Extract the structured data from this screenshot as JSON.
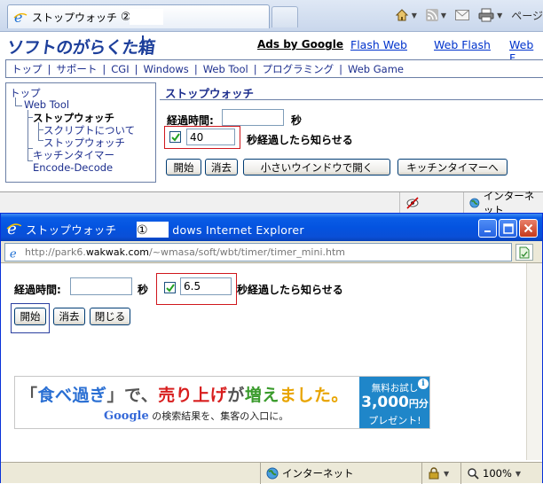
{
  "back_window": {
    "tab_title": "ストップウォッチ",
    "tab_marker": "②",
    "cmd": {
      "home_icon": "home-icon",
      "feeds_icon": "rss-icon",
      "mail_icon": "mail-icon",
      "print_icon": "printer-icon",
      "page_label": "ページ"
    },
    "logo": "ソフトのがらくた箱",
    "ads_label": "Ads by Google",
    "header_links": [
      "Flash Web",
      "Web Flash",
      "Web F"
    ],
    "nav": [
      "トップ",
      "サポート",
      "CGI",
      "Windows",
      "Web Tool",
      "プログラミング",
      "Web Game"
    ],
    "tree": {
      "top": "トップ",
      "web_tool": "Web Tool",
      "stopwatch": "ストップウォッチ",
      "about_script": "スクリプトについて",
      "stopwatch_sub": "ストップウォッチ",
      "kitchen_timer": "キッチンタイマー",
      "encode_decode": "Encode-Decode"
    },
    "content": {
      "title": "ストップウォッチ",
      "elapsed_label": "経過時間:",
      "elapsed_value": "",
      "sec_unit": "秒",
      "notify_value": "40",
      "notify_label": "秒経過したら知らせる",
      "notify_checked": true,
      "buttons": {
        "start": "開始",
        "clear": "消去",
        "open_small": "小さいウインドウで開く",
        "kitchen": "キッチンタイマーへ"
      }
    },
    "status": {
      "zone": "インターネット"
    }
  },
  "front_window": {
    "title": "ストップウォッチ",
    "title_marker": "①",
    "title_suffix": "dows Internet Explorer",
    "url_prefix": "http://park6.",
    "url_host": "wakwak.com",
    "url_path": "/~wmasa/soft/wbt/timer/timer_mini.htm",
    "elapsed_label": "経過時間:",
    "elapsed_value": "",
    "sec_unit": "秒",
    "notify_value": "6.5",
    "notify_label": "秒経過したら知らせる",
    "notify_checked": true,
    "buttons": {
      "start": "開始",
      "clear": "消去",
      "close": "閉じる"
    },
    "ad": {
      "open_quote": "「",
      "h1": "食べ過ぎ",
      "h2": "」で、",
      "h3": "売り上げ",
      "h4": "が",
      "h5": "増え",
      "h6": "ました。",
      "google": "Google",
      "sub": "の検索結果を、集客の入口に。",
      "offer_line1": "無料お試し",
      "offer_amount": "3,000",
      "offer_unit": "円分",
      "offer_line3": "プレゼント!",
      "info": "i"
    },
    "status": {
      "zone": "インターネット",
      "zoom": "100%"
    }
  },
  "colors": {
    "title_bar": "#0453e0",
    "nav_text": "#1d2f8e",
    "highlight_red": "#d0171d",
    "ad_blue": "#1f86c9"
  }
}
